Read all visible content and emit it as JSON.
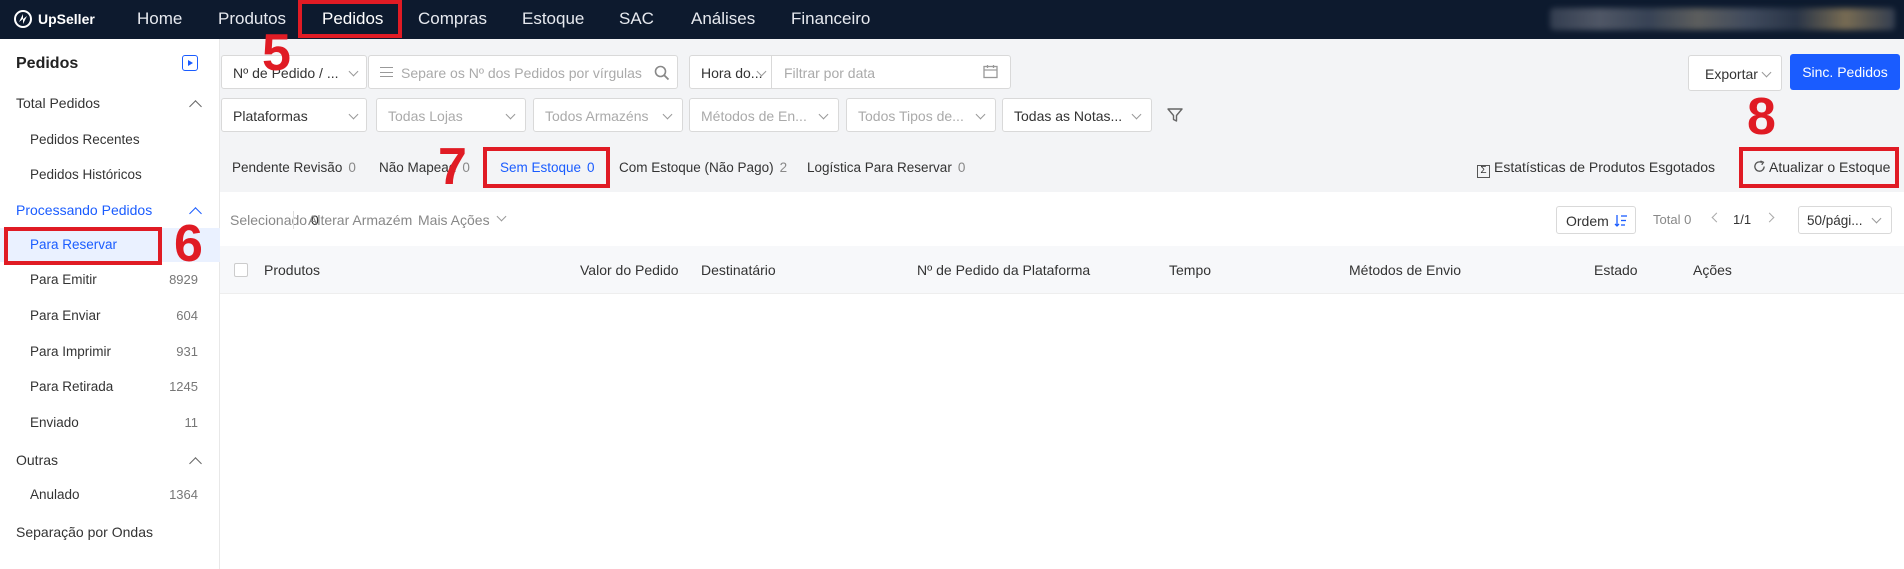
{
  "brand": "UpSeller",
  "nav": [
    "Home",
    "Produtos",
    "Pedidos",
    "Compras",
    "Estoque",
    "SAC",
    "Análises",
    "Financeiro"
  ],
  "sidebar": {
    "title": "Pedidos",
    "groups": {
      "total": "Total Pedidos",
      "processing": "Processando Pedidos",
      "others": "Outras"
    },
    "items": [
      {
        "label": "Pedidos Recentes",
        "count": ""
      },
      {
        "label": "Pedidos Históricos",
        "count": ""
      },
      {
        "label": "Para Reservar",
        "count": ""
      },
      {
        "label": "Para Emitir",
        "count": "8929"
      },
      {
        "label": "Para Enviar",
        "count": "604"
      },
      {
        "label": "Para Imprimir",
        "count": "931"
      },
      {
        "label": "Para Retirada",
        "count": "1245"
      },
      {
        "label": "Enviado",
        "count": "11"
      },
      {
        "label": "Anulado",
        "count": "1364"
      }
    ],
    "waves": "Separação por Ondas"
  },
  "filters": {
    "order_type": "Nº de Pedido / ...",
    "search_placeholder": "Separe os Nº dos Pedidos por vírgulas",
    "time_type": "Hora do...",
    "date_placeholder": "Filtrar por data",
    "export": "Exportar",
    "sync": "Sinc. Pedidos",
    "platforms": "Plataformas",
    "stores": "Todas Lojas",
    "warehouses": "Todos Armazéns",
    "shipping": "Métodos de En...",
    "types": "Todos Tipos de...",
    "notes": "Todas as Notas..."
  },
  "tabs": [
    {
      "label": "Pendente Revisão",
      "count": "0"
    },
    {
      "label": "Não Mapead",
      "count": "0"
    },
    {
      "label": "Sem Estoque",
      "count": "0"
    },
    {
      "label": "Com Estoque (Não Pago)",
      "count": "2"
    },
    {
      "label": "Logística Para Reservar",
      "count": "0"
    }
  ],
  "tab_actions": {
    "stats": "Estatísticas de Produtos Esgotados",
    "refresh": "Atualizar o Estoque"
  },
  "toolbar": {
    "selected_label": "Selecionado",
    "selected_count": "0",
    "change_warehouse": "Alterar Armazém",
    "more_actions": "Mais Ações",
    "order": "Ordem",
    "total": "Total 0",
    "page": "1/1",
    "per_page": "50/pági..."
  },
  "columns": [
    "Produtos",
    "Valor do Pedido",
    "Destinatário",
    "Nº de Pedido da Plataforma",
    "Tempo",
    "Métodos de Envio",
    "Estado",
    "Ações"
  ],
  "annotations": [
    "5",
    "6",
    "7",
    "8"
  ],
  "colors": {
    "accent": "#1a5cff",
    "topbar": "#0d1a2e",
    "highlight": "#e01b24"
  }
}
